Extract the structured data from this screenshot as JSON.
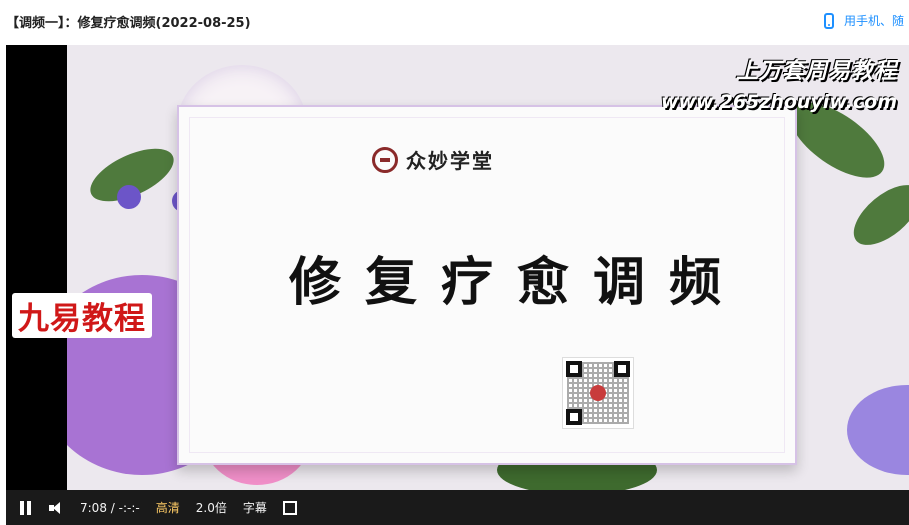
{
  "header": {
    "title": "【调频一】：修复疗愈调频(2022-08-25)",
    "mobile_label": "用手机、随"
  },
  "video": {
    "watermark_line1": "上万套周易教程",
    "watermark_line2": "www.265zhouyiw.com",
    "badge": "九易教程",
    "logo_text": "众妙学堂",
    "main_title": "修复疗愈调频"
  },
  "controls": {
    "current_time": "7:08",
    "separator": "/",
    "total_time": "-:-:-",
    "quality": "高清",
    "speed": "2.0倍",
    "subtitle": "字幕"
  },
  "colors": {
    "accent": "#1e90ff",
    "badge_text": "#d01818",
    "quality": "#ffcc66"
  }
}
